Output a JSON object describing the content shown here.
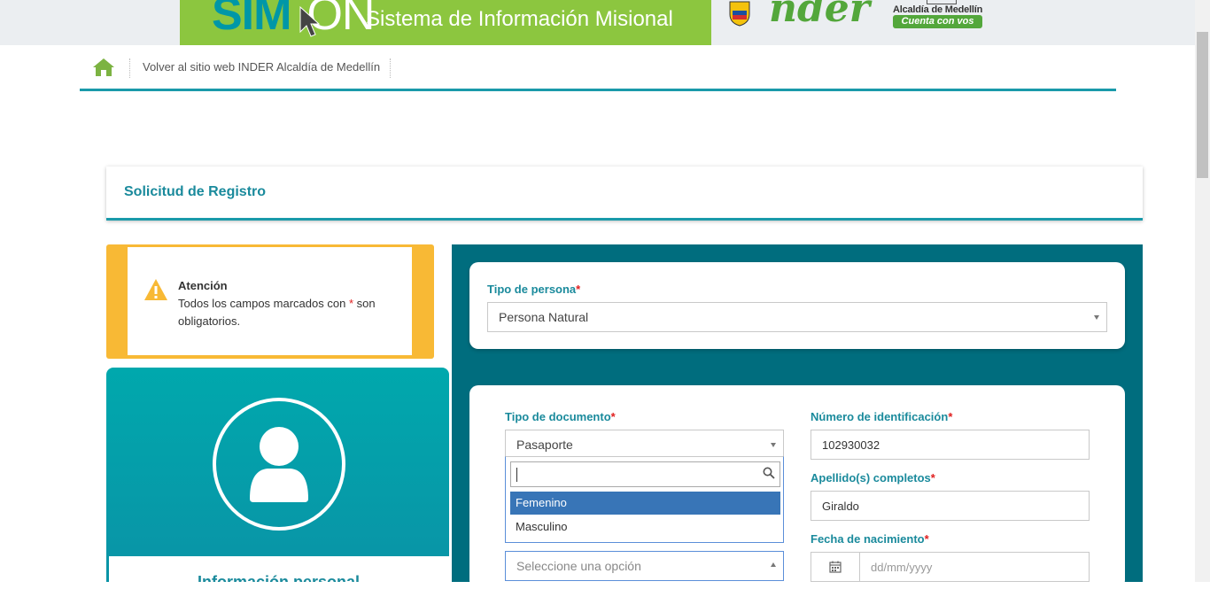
{
  "banner": {
    "logo_text": "SIM",
    "logo_text_on": "ON",
    "subtitle": "Sistema de Información Misional",
    "inder_logo": "nder",
    "medellin_top": "Alcaldía de Medellín",
    "medellin_bottom": "Cuenta con vos",
    "green": "#8cc63f",
    "teal": "#0097a7"
  },
  "nav": {
    "home_icon": "home-icon",
    "back_link": "Volver al sitio web INDER Alcaldía de Medellín"
  },
  "page": {
    "title": "Solicitud de Registro"
  },
  "attention": {
    "title": "Atención",
    "text_before": "Todos los campos marcados con ",
    "asterisk": "*",
    "text_after": " son obligatorios."
  },
  "profile": {
    "section_title": "Información personal"
  },
  "form": {
    "tipo_persona": {
      "label": "Tipo de persona",
      "value": "Persona Natural"
    },
    "tipo_documento": {
      "label": "Tipo de documento",
      "value": "Pasaporte"
    },
    "numero_identificacion": {
      "label": "Número de identificación",
      "value": "102930032"
    },
    "apellidos": {
      "label": "Apellido(s) completos",
      "value": "Giraldo"
    },
    "fecha_nacimiento": {
      "label": "Fecha de nacimiento",
      "placeholder": "dd/mm/yyyy"
    },
    "genero": {
      "placeholder": "Seleccione una opción"
    },
    "required_mark": "*"
  },
  "dropdown": {
    "search_value": "",
    "options": [
      "Femenino",
      "Masculino"
    ],
    "active_index": 0
  },
  "colors": {
    "teal_dark": "#006d7e",
    "accent": "#1a8a9c",
    "warning": "#f8b935",
    "selected": "#3875b7"
  }
}
